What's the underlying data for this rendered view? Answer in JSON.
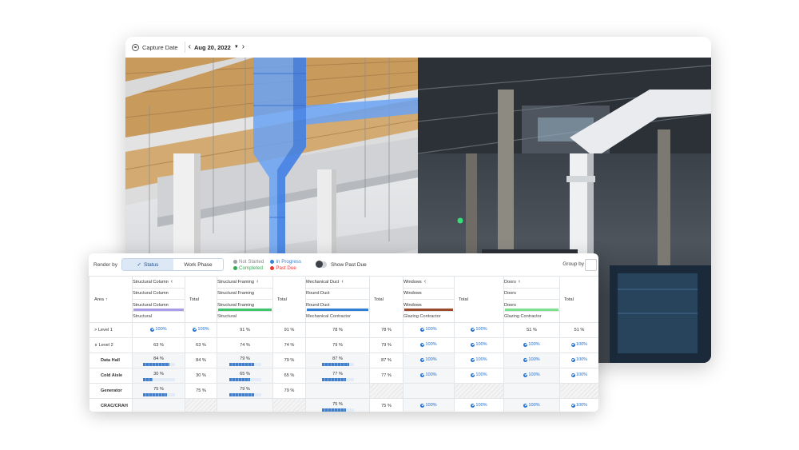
{
  "viewer": {
    "capture_label": "Capture Date",
    "date": "Aug 20, 2022",
    "prev_icon": "chevron-left-icon",
    "next_icon": "chevron-right-icon",
    "dropdown_icon": "caret-down-icon"
  },
  "controls": {
    "render_by_label": "Render by",
    "status_tab": "Status",
    "work_phase_tab": "Work Phase",
    "legend": {
      "not_started": "Not Started",
      "in_progress": "In Progress",
      "completed": "Completed",
      "past_due": "Past Due"
    },
    "legend_colors": {
      "not_started": "#9aa0a6",
      "in_progress": "#3b82d6",
      "completed": "#34a853",
      "past_due": "#e53935"
    },
    "show_past_due_label": "Show Past Due",
    "group_by_label": "Group by"
  },
  "table": {
    "area_header": "Area",
    "sort_icon": "↑",
    "total_header": "Total",
    "groups": [
      {
        "title": "Structural Column",
        "row2": "Structural Column",
        "row3": "Structural Column",
        "row4": "Structural",
        "color": "#a89be8"
      },
      {
        "title": "Structural Framing",
        "row2": "Structural Framing",
        "row3": "Structural Framing",
        "row4": "Structural",
        "color": "#3ec46d"
      },
      {
        "title": "Mechanical Duct",
        "row2": "Round Duct",
        "row3": "Round Duct",
        "row4": "Mechanical Contractor",
        "color": "#2f7fd6"
      },
      {
        "title": "Windows",
        "row2": "Windows",
        "row3": "Windows",
        "row4": "Glazing Contractor",
        "color": "#9b4a2c"
      },
      {
        "title": "Doors",
        "row2": "Doors",
        "row3": "Doors",
        "row4": "Glazing Contractor",
        "color": "#7de08f"
      }
    ],
    "rows": [
      {
        "label": "> Level 1",
        "type": "level",
        "cells": [
          "100%",
          "100%",
          "91 %",
          "91 %",
          "78 %",
          "78 %",
          "100%",
          "100%",
          "51 %",
          "51 %"
        ]
      },
      {
        "label": "∨ Level 2",
        "type": "level",
        "cells": [
          "63 %",
          "63 %",
          "74 %",
          "74 %",
          "79 %",
          "79 %",
          "100%",
          "100%",
          "100%",
          "100%"
        ]
      },
      {
        "label": "Data Hall",
        "type": "sub",
        "cells": [
          "84 %",
          "84 %",
          "79 %",
          "79 %",
          "87 %",
          "87 %",
          "100%",
          "100%",
          "100%",
          "100%"
        ]
      },
      {
        "label": "Cold Aisle",
        "type": "sub",
        "cells": [
          "30 %",
          "30 %",
          "65 %",
          "65 %",
          "77 %",
          "77 %",
          "100%",
          "100%",
          "100%",
          "100%"
        ]
      },
      {
        "label": "Generator",
        "type": "sub",
        "cells": [
          "75 %",
          "75 %",
          "79 %",
          "79 %",
          "",
          "",
          "",
          "",
          "",
          ""
        ]
      },
      {
        "label": "CRAC/CRAH",
        "type": "sub",
        "cells": [
          "",
          "",
          "",
          "",
          "75 %",
          "75 %",
          "100%",
          "100%",
          "100%",
          "100%"
        ]
      }
    ],
    "bars": {
      "row2_col0": 0.84,
      "row2_col2": 0.79,
      "row2_col4": 0.87,
      "row3_col0": 0.3,
      "row3_col2": 0.65,
      "row3_col4": 0.77,
      "row4_col0": 0.75,
      "row4_col2": 0.79,
      "row5_col4": 0.75
    }
  }
}
